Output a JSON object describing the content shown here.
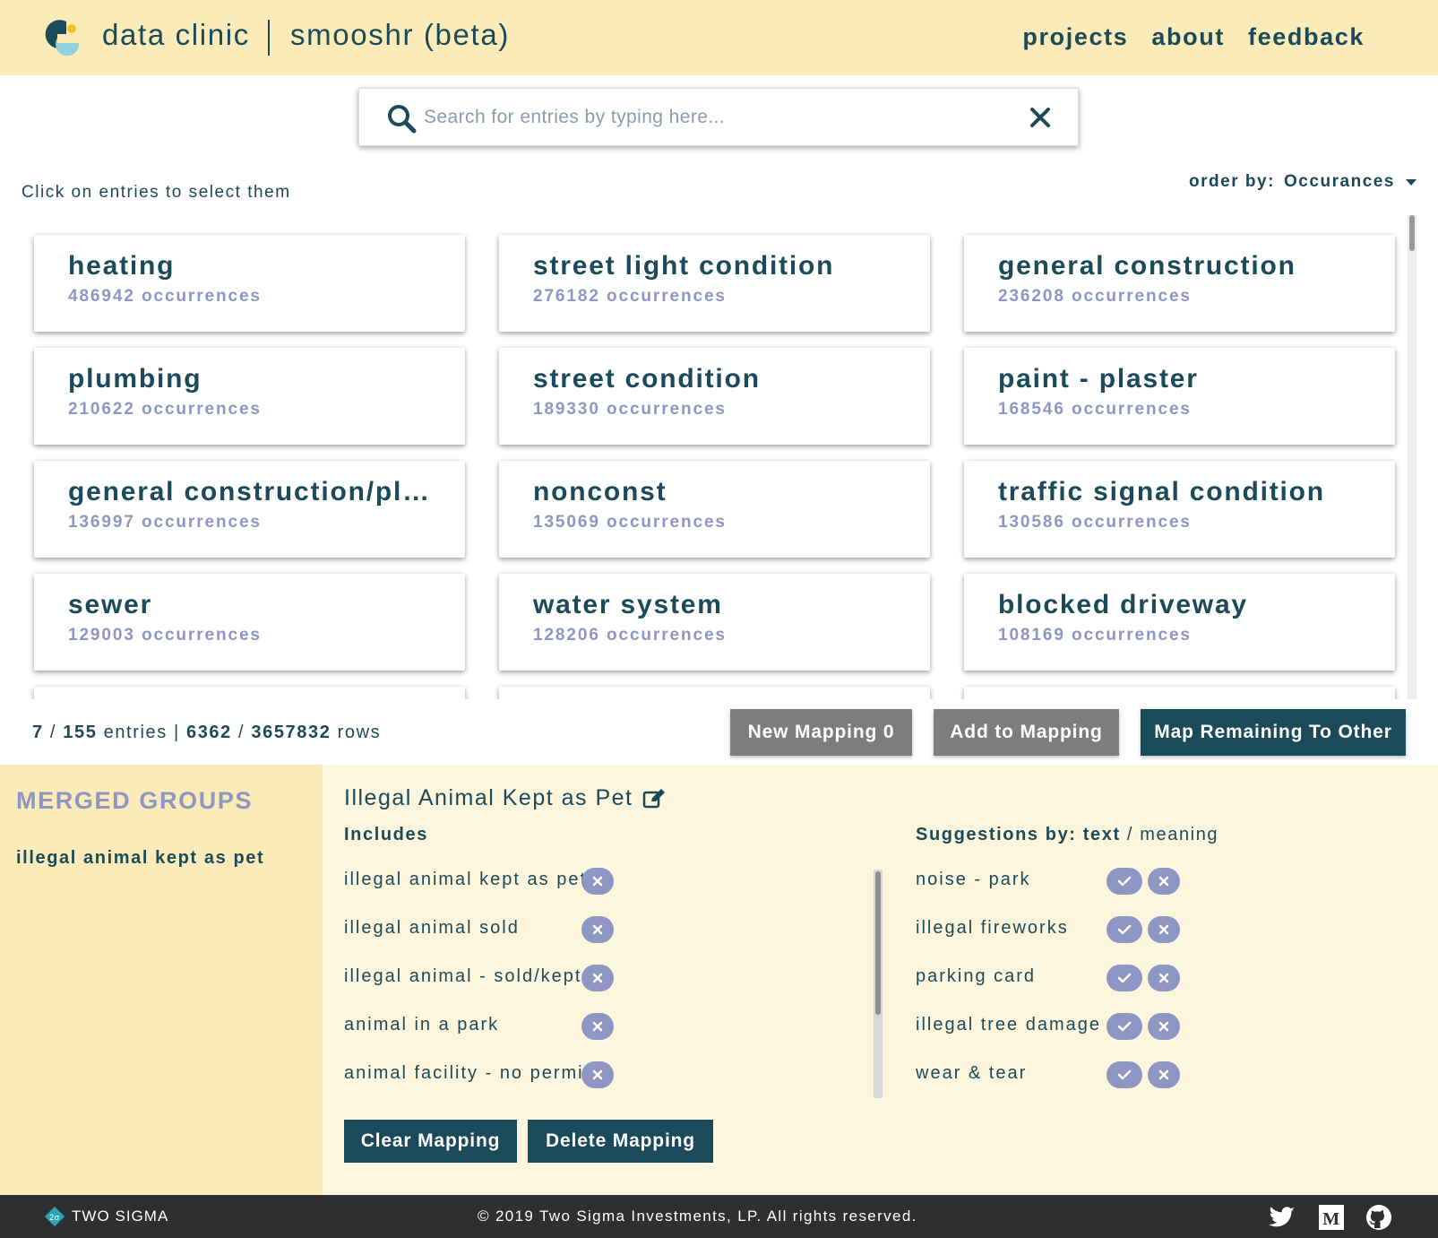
{
  "header": {
    "brand": "data clinic",
    "product": "smooshr (beta)",
    "nav": [
      "projects",
      "about",
      "feedback"
    ]
  },
  "search": {
    "placeholder": "Search for entries by typing here..."
  },
  "hint": "Click on entries to select them",
  "order": {
    "label": "order by:",
    "value": "Occurances"
  },
  "entries": [
    {
      "name": "heating",
      "count": "486942 occurrences"
    },
    {
      "name": "street light condition",
      "count": "276182 occurrences"
    },
    {
      "name": "general construction",
      "count": "236208 occurrences"
    },
    {
      "name": "plumbing",
      "count": "210622 occurrences"
    },
    {
      "name": "street condition",
      "count": "189330 occurrences"
    },
    {
      "name": "paint - plaster",
      "count": "168546 occurrences"
    },
    {
      "name": "general construction/plum...",
      "count": "136997 occurrences"
    },
    {
      "name": "nonconst",
      "count": "135069 occurrences"
    },
    {
      "name": "traffic signal condition",
      "count": "130586 occurrences"
    },
    {
      "name": "sewer",
      "count": "129003 occurrences"
    },
    {
      "name": "water system",
      "count": "128206 occurrences"
    },
    {
      "name": "blocked driveway",
      "count": "108169 occurrences"
    }
  ],
  "stats": {
    "selected_entries": "7",
    "total_entries": "155",
    "entries_word": "entries",
    "selected_rows": "6362",
    "total_rows": "3657832",
    "rows_word": "rows"
  },
  "actions": {
    "new_mapping": "New Mapping 0",
    "add_to_mapping": "Add to Mapping",
    "map_remaining": "Map Remaining To Other"
  },
  "merged_groups": {
    "title": "MERGED GROUPS",
    "items": [
      "illegal animal kept as pet"
    ]
  },
  "mapping": {
    "title": "Illegal Animal Kept as Pet",
    "includes_label": "Includes",
    "includes": [
      "illegal animal kept as pet",
      "illegal animal sold",
      "illegal animal - sold/kept",
      "animal in a park",
      "animal facility - no permit"
    ],
    "suggestions_label": "Suggestions by:",
    "suggestions_mode_text": "text",
    "suggestions_mode_meaning": "meaning",
    "suggestions": [
      "noise - park",
      "illegal fireworks",
      "parking card",
      "illegal tree damage",
      "wear & tear"
    ],
    "clear_label": "Clear Mapping",
    "delete_label": "Delete Mapping"
  },
  "footer": {
    "company": "TWO SIGMA",
    "copyright": "© 2019 Two Sigma Investments, LP. All rights reserved."
  },
  "colors": {
    "header_bg": "#fbebb8",
    "primary": "#1b4a5a",
    "accent": "#8e96c4",
    "bottom_bg": "#fdf5dc",
    "footer_bg": "#2e2f31"
  }
}
